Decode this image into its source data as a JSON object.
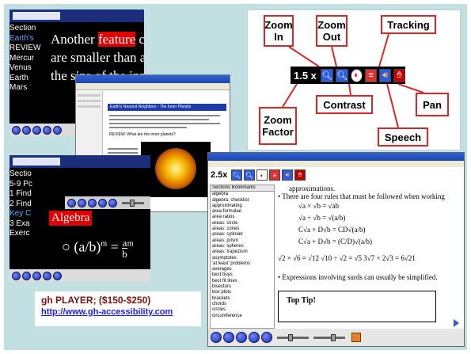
{
  "caption": {
    "title": "gh PLAYER; ($150-$250)",
    "link": "http://www.gh-accessibility.com"
  },
  "left_top_shot": {
    "side_lines": [
      "Section",
      "Earth's",
      "REVIEW",
      "Mercur",
      "Venus",
      "Earth",
      "Mars"
    ],
    "line1a": "Another ",
    "highlight": "feature",
    "line1b": " co",
    "line2": "are smaller than all",
    "line3": "the size of the inn"
  },
  "middle_shot": {
    "title": "Earth's Nearest Neighbors - The Inner Planets",
    "question": "REVIEW: What are the inner planets?"
  },
  "left_bottom_shot": {
    "side_lines": [
      "Sectio",
      "5-9 Pc",
      "1 Find",
      "2 Find",
      "Key C",
      "3 Exa",
      "Exerc"
    ],
    "algebra": "Algebra",
    "formula_lhs": "(a/b)",
    "formula_exp": "m",
    "formula_rhs_num": "a",
    "formula_rhs_den": "b",
    "formula_rhs_exp": "m"
  },
  "toolbar_callout": {
    "zoom_value": "1.5 x",
    "labels": {
      "zoom_in": "Zoom In",
      "zoom_out": "Zoom Out",
      "tracking": "Tracking",
      "contrast": "Contrast",
      "pan": "Pan",
      "zoom_factor": "Zoom Factor",
      "speech": "Speech"
    }
  },
  "bottom_right_shot": {
    "zoom_value": "2.5x",
    "sidebar_header": "Sections  Bookmarks",
    "sidebar_items": [
      "algebra",
      "algebra: checklist",
      "approximating",
      "area formulae",
      "area ratios",
      "areas: circle",
      "areas: cones",
      "areas: cylinder",
      "areas: prism",
      "areas: spheres",
      "areas: trapezium",
      "asymptotes",
      "'at least' problems",
      "averages",
      "best buys",
      "best fit lines",
      "bisectors",
      "box plots",
      "brackets",
      "chords",
      "circles",
      "circumference"
    ],
    "text_top": "approximations.",
    "bullet1": "There are four rules that must be followed when working",
    "rules": [
      "√a × √b = √ab",
      "√a ÷ √b = √(a/b)",
      "C√a × D√b = CD√(a/b)",
      "C√a + D√b = (C/D)√(a/b)"
    ],
    "examples": "√2 × √6 = √12    √10 ÷ √2 = √5    3√7 × 2√3 = 6√21",
    "bullet2": "Expressions involving surds can usually be simplified.",
    "tip": "Top Tip!"
  },
  "colors": {
    "callout_border": "#d62828",
    "link": "#1a1aff",
    "caption_title": "#7a1010",
    "background": "#c2e0e2"
  }
}
